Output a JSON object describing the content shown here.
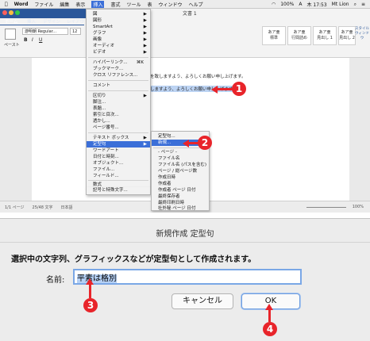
{
  "menubar": {
    "app": "Word",
    "items": [
      "ファイル",
      "編集",
      "表示",
      "挿入",
      "書式",
      "ツール",
      "表",
      "ウィンドウ",
      "ヘルプ"
    ],
    "active": "挿入",
    "status_right": [
      "100%",
      "A",
      "木 17:53",
      "Mt Lion"
    ]
  },
  "word_window": {
    "title": "文書 1",
    "tabs": [
      "ホーム",
      "挿入",
      "デザイン",
      "レイアウ"
    ],
    "font_name": "游明朝 Regular...",
    "font_size": "12",
    "paste_label": "ペースト",
    "styles": [
      {
        "preview": "あア亜",
        "name": "標準"
      },
      {
        "preview": "あア亜",
        "name": "行間詰め"
      },
      {
        "preview": "あア亜",
        "name": "見出し 1"
      },
      {
        "preview": "あア亜",
        "name": "見出し 2"
      }
    ],
    "styles_pane": "スタイル\nウィンドウ",
    "doc_text_line": "準備を致しますよう、よろしくお願い申し上げます。",
    "selected_text": "を致しますよう、よろしくお願い申し上げます。",
    "status_left": [
      "1/1 ページ",
      "25/48 文字",
      "日本語"
    ],
    "zoom": "100%"
  },
  "insert_menu": {
    "items": [
      {
        "label": "図",
        "arrow": true
      },
      {
        "label": "図形",
        "arrow": true
      },
      {
        "label": "SmartArt",
        "arrow": true
      },
      {
        "label": "グラフ",
        "arrow": true
      },
      {
        "label": "画像",
        "arrow": true
      },
      {
        "label": "オーディオ",
        "arrow": true
      },
      {
        "label": "ビデオ",
        "arrow": true
      },
      {
        "label": "ハイパーリンク...",
        "shortcut": "⌘K"
      },
      {
        "label": "ブックマーク..."
      },
      {
        "label": "クロス リファレンス..."
      },
      {
        "label": "コメント"
      },
      {
        "label": "区切り",
        "arrow": true
      },
      {
        "label": "脚注..."
      },
      {
        "label": "表題..."
      },
      {
        "label": "索引と目次..."
      },
      {
        "label": "透かし..."
      },
      {
        "label": "ページ番号..."
      },
      {
        "label": "テキスト ボックス",
        "arrow": true
      },
      {
        "label": "定型句",
        "arrow": true,
        "highlight": true
      },
      {
        "label": "ワードアート"
      },
      {
        "label": "日付と時刻..."
      },
      {
        "label": "オブジェクト..."
      },
      {
        "label": "ファイル..."
      },
      {
        "label": "フィールド..."
      },
      {
        "label": "数式"
      },
      {
        "label": "記号と特殊文字..."
      }
    ]
  },
  "autotext_submenu": {
    "items": [
      {
        "label": "定型句..."
      },
      {
        "label": "新規...",
        "highlight": true
      },
      {
        "label": "- ページ -"
      },
      {
        "label": "ファイル名"
      },
      {
        "label": "ファイル名 (パスを含む)"
      },
      {
        "label": "ページ / 総ページ数"
      },
      {
        "label": "作成日時"
      },
      {
        "label": "作成者"
      },
      {
        "label": "作成者 ページ 日付"
      },
      {
        "label": "最終保存者"
      },
      {
        "label": "最終印刷日時"
      },
      {
        "label": "社外秘 ページ 日付"
      }
    ]
  },
  "callouts": [
    "1",
    "2",
    "3",
    "4"
  ],
  "dialog": {
    "title": "新規作成 定型句",
    "message": "選択中の文字列、グラフィックスなどが定型句として作成されます。",
    "name_label": "名前:",
    "name_value": "平素は格別",
    "cancel_label": "キャンセル",
    "ok_label": "OK"
  },
  "colors": {
    "accent": "#3b6fd8",
    "word_blue": "#2b579a",
    "callout_red": "#e8242a"
  }
}
